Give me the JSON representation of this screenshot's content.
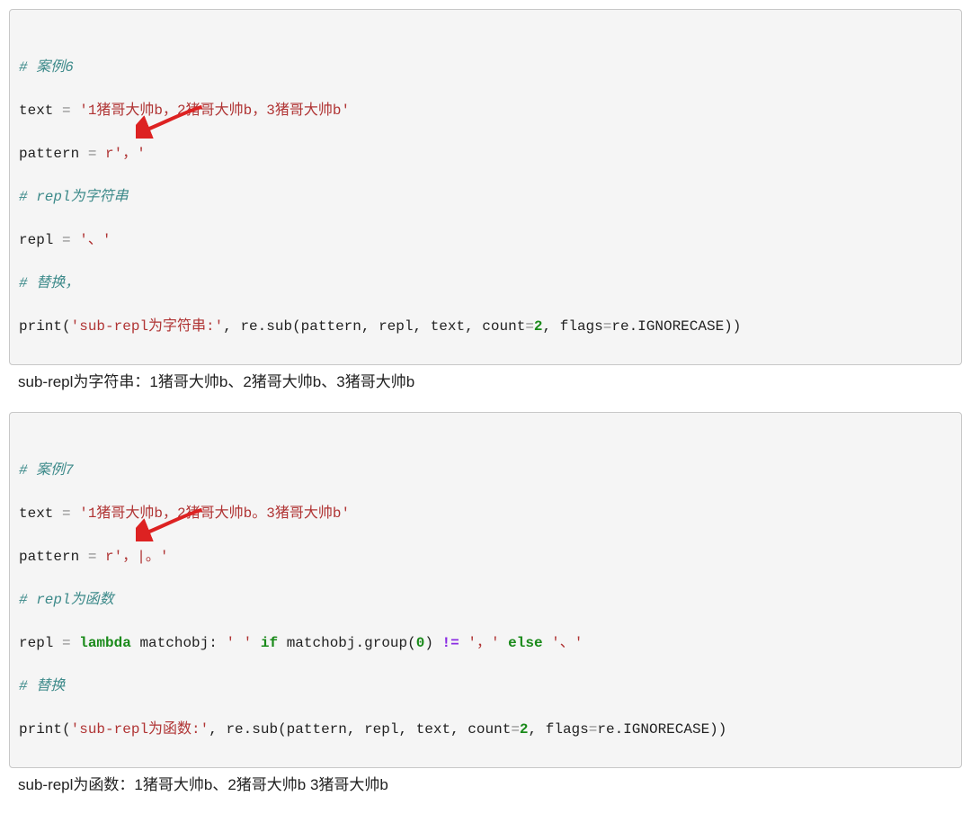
{
  "block1": {
    "c1": "# 案例6",
    "l1_a": "text ",
    "l1_op": "=",
    "l1_s": " '1猪哥大帅b，2猪哥大帅b，3猪哥大帅b'",
    "l2_a": "pattern ",
    "l2_op": "=",
    "l2_s": " r'，'",
    "c2": "# repl为字符串",
    "l3_a": "repl ",
    "l3_op": "=",
    "l3_s": " '、'",
    "c3": "# 替换，",
    "l4_fn": "print",
    "l4_p1": "(",
    "l4_s1": "'sub-repl为字符串:'",
    "l4_mid": ", re.sub(pattern, repl, text, count",
    "l4_eq": "=",
    "l4_n1": "2",
    "l4_mid2": ", flags",
    "l4_eq2": "=",
    "l4_tail": "re.IGNORECASE))"
  },
  "out1": "sub-repl为字符串：1猪哥大帅b、2猪哥大帅b、3猪哥大帅b",
  "block2": {
    "c1": "# 案例7",
    "l1_a": "text ",
    "l1_op": "=",
    "l1_s": " '1猪哥大帅b，2猪哥大帅b。3猪哥大帅b'",
    "l2_a": "pattern ",
    "l2_op": "=",
    "l2_s": " r'，|。'",
    "c2": "# repl为函数",
    "l3_a": "repl ",
    "l3_op": "=",
    "l3_kw1": " lambda",
    "l3_mid1": " matchobj: ",
    "l3_s1": "' '",
    "l3_kw2": " if",
    "l3_mid2": " matchobj.group(",
    "l3_n0": "0",
    "l3_mid3": ") ",
    "l3_neq": "!=",
    "l3_sp": " ",
    "l3_s2": "'，'",
    "l3_kw3": " else",
    "l3_s3": " '、'",
    "c3": "# 替换",
    "l4_fn": "print",
    "l4_p1": "(",
    "l4_s1": "'sub-repl为函数:'",
    "l4_mid": ", re.sub(pattern, repl, text, count",
    "l4_eq": "=",
    "l4_n1": "2",
    "l4_mid2": ", flags",
    "l4_eq2": "=",
    "l4_tail": "re.IGNORECASE))"
  },
  "out2": "sub-repl为函数：1猪哥大帅b、2猪哥大帅b  3猪哥大帅b"
}
